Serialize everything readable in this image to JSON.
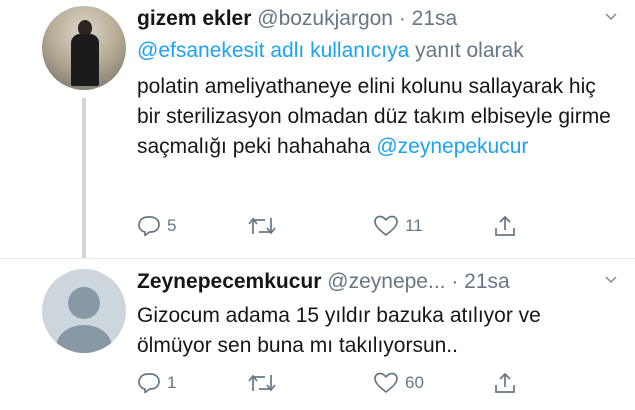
{
  "tweets": [
    {
      "author_name": "gizem ekler",
      "handle": "@bozukjargon",
      "separator": "·",
      "time": "21sa",
      "reply_to": {
        "mention": "@efsanekesit adlı kullanıcıya",
        "suffix": "yanıt olarak"
      },
      "text": "polatin ameliyathaneye elini kolunu sallayarak hiç bir sterilizasyon olmadan düz takım elbiseyle girme saçmalığı peki hahahaha",
      "text_mention": "@zeynepekucur",
      "replies": "5",
      "retweets": "",
      "likes": "11",
      "icons": [
        "chevron-down-icon",
        "reply-icon",
        "retweet-icon",
        "like-icon",
        "share-icon"
      ]
    },
    {
      "author_name": "Zeynepecemkucur",
      "handle": "@zeynepe...",
      "separator": "·",
      "time": "21sa",
      "text": "Gizocum adama 15 yıldır bazuka atılıyor ve ölmüyor sen buna mı takılıyorsun..",
      "replies": "1",
      "retweets": "",
      "likes": "60",
      "icons": [
        "chevron-down-icon",
        "reply-icon",
        "retweet-icon",
        "like-icon",
        "share-icon"
      ]
    }
  ],
  "colors": {
    "accent": "#1da1f2",
    "secondary_text": "#657786",
    "primary_text": "#14171a",
    "thread_line": "#ccd6dd"
  }
}
